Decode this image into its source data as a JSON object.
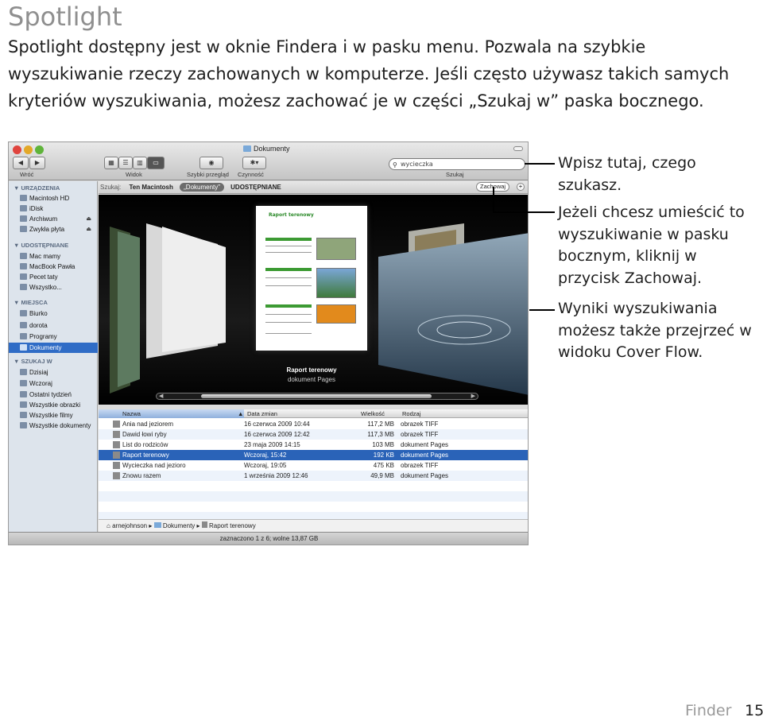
{
  "heading": "Spotlight",
  "intro": "Spotlight dostępny jest w oknie Findera i w pasku menu. Pozwala na szybkie wyszukiwanie rzeczy zachowanych w komputerze. Jeśli często używasz takich samych kryteriów wyszukiwania, możesz zachować je w części „Szukaj w” paska bocznego.",
  "finder": {
    "title": "Dokumenty",
    "toolbar": {
      "back_label": "Wróć",
      "view_label": "Widok",
      "quicklook_label": "Szybki przegląd",
      "action_label": "Czynność",
      "search_label": "Szukaj",
      "search_value": "wycieczka"
    },
    "sidebar": {
      "devices_header": "URZĄDZENIA",
      "devices": [
        "Macintosh HD",
        "iDisk",
        "Archiwum",
        "Zwykła płyta"
      ],
      "shared_header": "UDOSTĘPNIANE",
      "shared": [
        "Mac mamy",
        "MacBook Pawła",
        "Pecet taty",
        "Wszystko..."
      ],
      "places_header": "MIEJSCA",
      "places": [
        "Biurko",
        "dorota",
        "Programy",
        "Dokumenty"
      ],
      "search_header": "SZUKAJ W",
      "searches": [
        "Dzisiaj",
        "Wczoraj",
        "Ostatni tydzień",
        "Wszystkie obrazki",
        "Wszystkie filmy",
        "Wszystkie dokumenty"
      ]
    },
    "scopebar": {
      "search_in": "Szukaj:",
      "scope1": "Ten Macintosh",
      "scope2": "„Dokumenty”",
      "scope3": "UDOSTĘPNIANE",
      "save": "Zachowaj",
      "add": "+"
    },
    "coverflow": {
      "doc_heading": "Raport terenowy",
      "caption_title": "Raport terenowy",
      "caption_kind": "dokument Pages"
    },
    "list": {
      "columns": [
        "Nazwa",
        "Data zmian",
        "Wielkość",
        "Rodzaj"
      ],
      "rows": [
        {
          "name": "Ania nad jeziorem",
          "date": "16 czerwca 2009 10:44",
          "size": "117,2 MB",
          "kind": "obrazek TIFF"
        },
        {
          "name": "Dawid łowi ryby",
          "date": "16 czerwca 2009 12:42",
          "size": "117,3 MB",
          "kind": "obrazek TIFF"
        },
        {
          "name": "List do rodziców",
          "date": "23 maja 2009 14:15",
          "size": "103 MB",
          "kind": "dokument Pages"
        },
        {
          "name": "Raport terenowy",
          "date": "Wczoraj, 15:42",
          "size": "192 KB",
          "kind": "dokument Pages"
        },
        {
          "name": "Wycieczka nad jezioro",
          "date": "Wczoraj, 19:05",
          "size": "475 KB",
          "kind": "obrazek TIFF"
        },
        {
          "name": "Znowu razem",
          "date": "1 września 2009 12:46",
          "size": "49,9 MB",
          "kind": "dokument Pages"
        }
      ],
      "selected_index": 3
    },
    "path": [
      "arnejohnson",
      "Dokumenty",
      "Raport terenowy"
    ],
    "status": "zaznaczono 1 z 6; wolne 13,87 GB"
  },
  "callouts": {
    "search": "Wpisz tutaj, czego szukasz.",
    "save": "Jeżeli chcesz umieścić to wyszukiwanie w pasku bocznym, kliknij w przycisk Zachowaj.",
    "results": "Wyniki wyszukiwania możesz także przejrzeć w widoku Cover Flow."
  },
  "footer": {
    "section": "Finder",
    "page": "15"
  }
}
